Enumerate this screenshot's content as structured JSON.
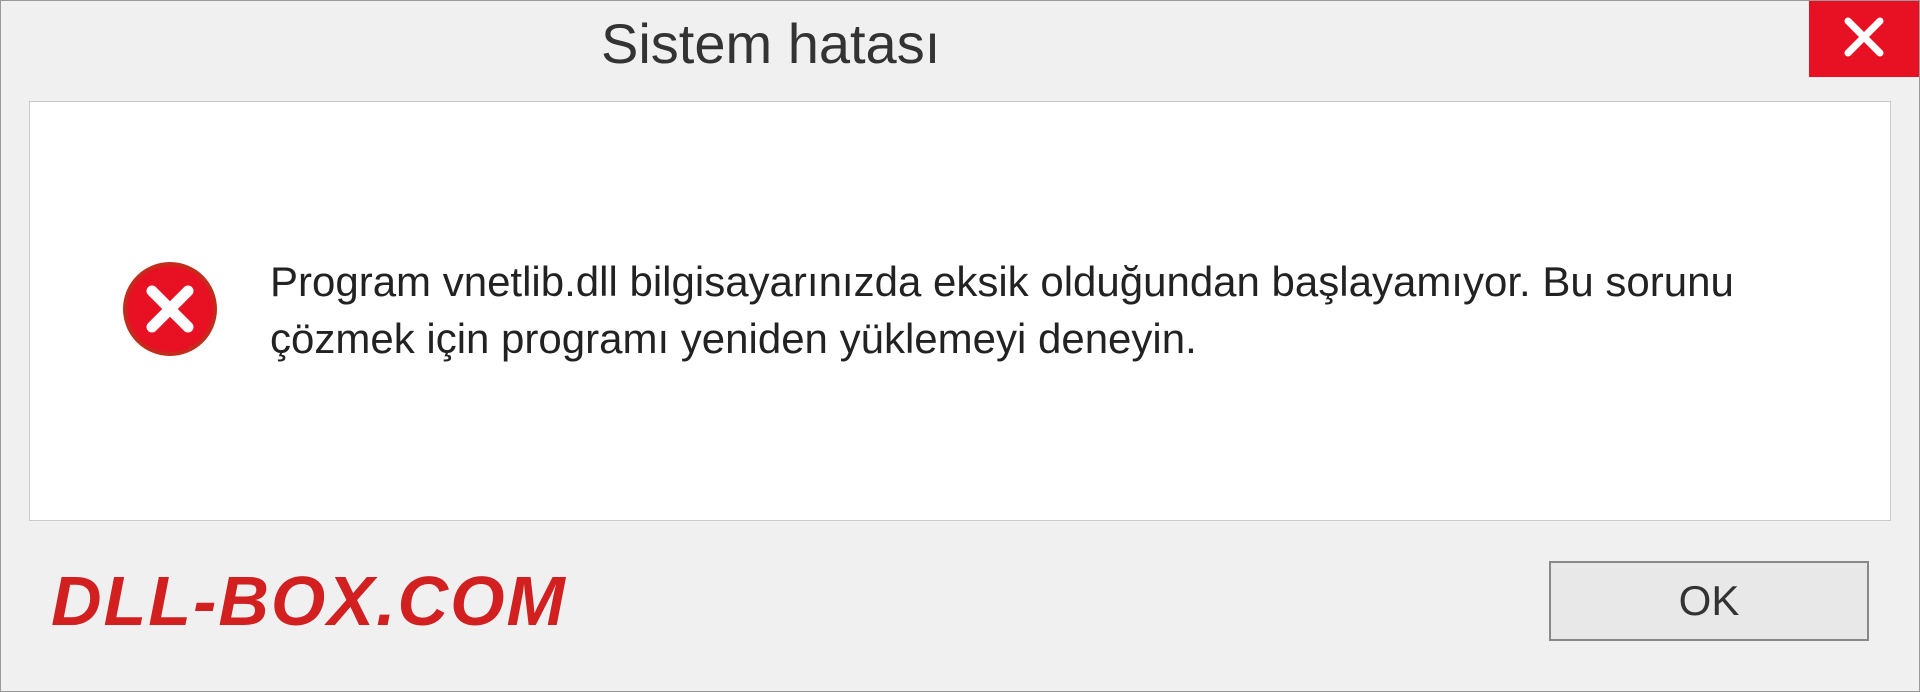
{
  "titlebar": {
    "title": "Sistem hatası"
  },
  "content": {
    "message": "Program vnetlib.dll bilgisayarınızda eksik olduğundan başlayamıyor. Bu sorunu çözmek için programı yeniden yüklemeyi deneyin."
  },
  "footer": {
    "watermark": "DLL-BOX.COM",
    "ok_label": "OK"
  }
}
